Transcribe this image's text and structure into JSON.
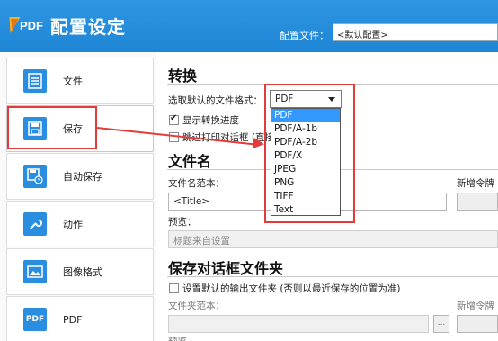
{
  "header": {
    "logo_text": "PDF",
    "title": "配置设定",
    "config_label": "配置文件：",
    "config_value": "<默认配置>"
  },
  "sidebar": {
    "items": [
      {
        "label": "文件",
        "icon": "document-icon"
      },
      {
        "label": "保存",
        "icon": "save-icon",
        "active": true
      },
      {
        "label": "自动保存",
        "icon": "auto-save-icon"
      },
      {
        "label": "动作",
        "icon": "wrench-icon"
      },
      {
        "label": "图像格式",
        "icon": "image-icon"
      },
      {
        "label": "PDF",
        "icon": "pdf-icon",
        "icon_text": "PDF"
      }
    ]
  },
  "convert": {
    "title": "转换",
    "format_label": "选取默认的文件格式：",
    "format_value": "PDF",
    "format_options": [
      "PDF",
      "PDF/A-1b",
      "PDF/A-2b",
      "PDF/X",
      "JPEG",
      "PNG",
      "TIFF",
      "Text"
    ],
    "show_progress_label": "显示转换进度",
    "hidden_option_label": "跳过打印对话框 (直接"
  },
  "filename": {
    "title": "文件名",
    "template_label": "文件名范本：",
    "template_value": "<Title>",
    "add_token_label": "新增令牌",
    "preview_label": "预览：",
    "preview_value": "标题来自设置"
  },
  "save_dialog": {
    "title": "保存对话框文件夹",
    "default_folder_label": "设置默认的输出文件夹 (否则以最近保存的位置为准)",
    "folder_template_label": "文件夹范本：",
    "add_token_label": "新增令牌",
    "browse_label": "...",
    "preview_partial": "预览"
  },
  "colors": {
    "header_blue": "#1f85d6",
    "annotation_red": "#e53a3a",
    "selection_blue": "#3399ff"
  }
}
